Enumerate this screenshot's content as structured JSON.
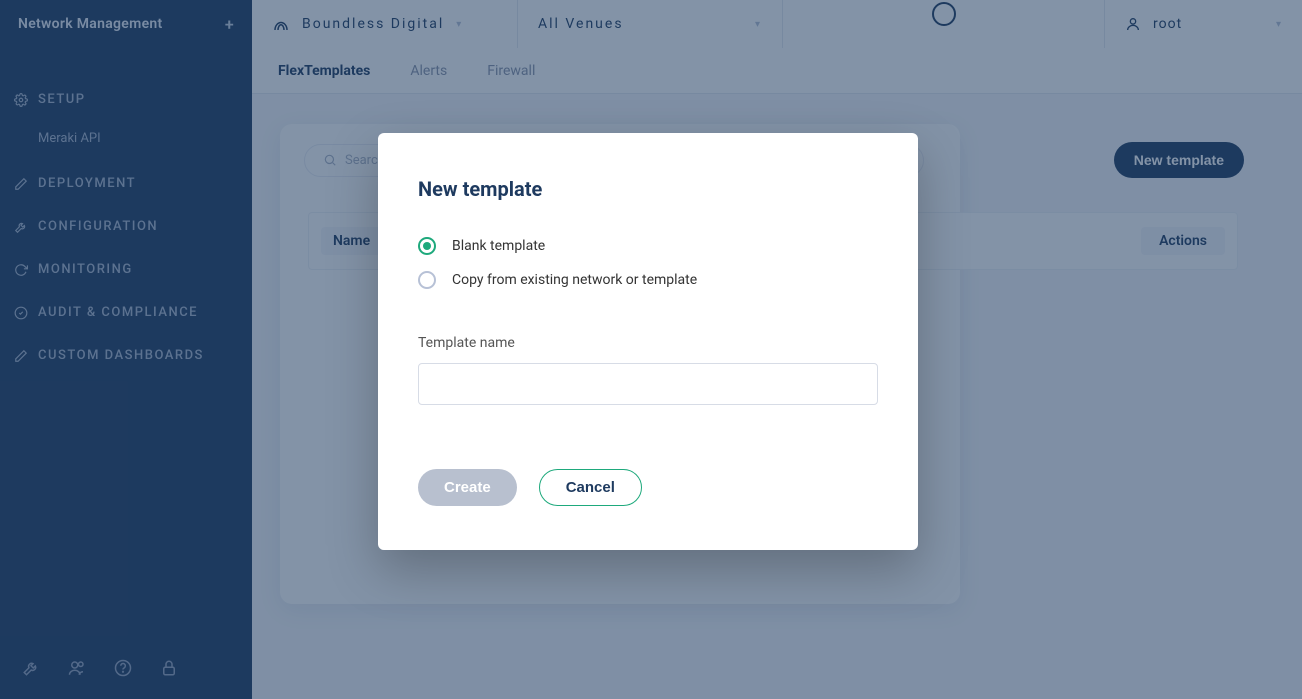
{
  "sidebar": {
    "title": "Network Management",
    "groups": [
      {
        "icon": "gear",
        "label": "SETUP",
        "sub": [
          "Meraki API"
        ]
      },
      {
        "icon": "pencil",
        "label": "DEPLOYMENT"
      },
      {
        "icon": "wrench",
        "label": "CONFIGURATION"
      },
      {
        "icon": "refresh",
        "label": "MONITORING"
      },
      {
        "icon": "check",
        "label": "AUDIT & COMPLIANCE"
      },
      {
        "icon": "pencil",
        "label": "CUSTOM DASHBOARDS"
      }
    ],
    "footer_icons": [
      "wrench",
      "users",
      "help",
      "lock"
    ]
  },
  "topbar": {
    "org": "Boundless Digital",
    "venues": "All Venues",
    "user": "root"
  },
  "tabs": [
    {
      "label": "FlexTemplates",
      "active": true
    },
    {
      "label": "Alerts",
      "active": false
    },
    {
      "label": "Firewall",
      "active": false
    }
  ],
  "card": {
    "search_placeholder": "Search",
    "new_button": "New template",
    "columns": {
      "name": "Name",
      "actions": "Actions"
    }
  },
  "modal": {
    "title": "New template",
    "option_blank": "Blank template",
    "option_copy": "Copy from existing network or template",
    "selected": "blank",
    "name_label": "Template name",
    "name_value": "",
    "create": "Create",
    "cancel": "Cancel"
  }
}
